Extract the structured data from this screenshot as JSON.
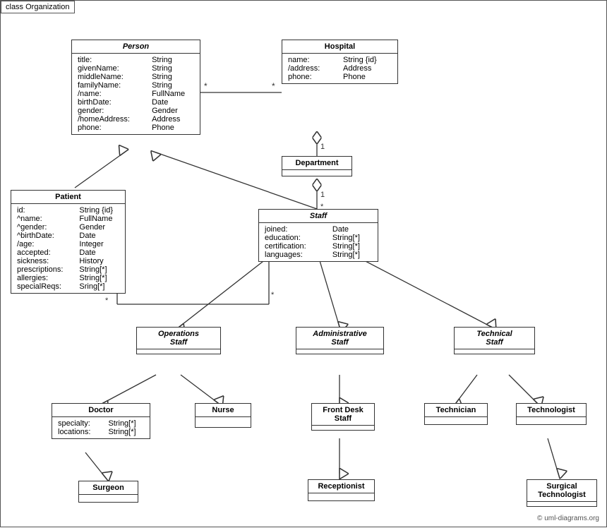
{
  "diagram": {
    "title": "class Organization",
    "copyright": "© uml-diagrams.org",
    "classes": {
      "person": {
        "name": "Person",
        "italic": true,
        "attrs": [
          [
            "title:",
            "String"
          ],
          [
            "givenName:",
            "String"
          ],
          [
            "middleName:",
            "String"
          ],
          [
            "familyName:",
            "String"
          ],
          [
            "/name:",
            "FullName"
          ],
          [
            "birthDate:",
            "Date"
          ],
          [
            "gender:",
            "Gender"
          ],
          [
            "/homeAddress:",
            "Address"
          ],
          [
            "phone:",
            "Phone"
          ]
        ]
      },
      "hospital": {
        "name": "Hospital",
        "italic": false,
        "attrs": [
          [
            "name:",
            "String {id}"
          ],
          [
            "/address:",
            "Address"
          ],
          [
            "phone:",
            "Phone"
          ]
        ]
      },
      "patient": {
        "name": "Patient",
        "italic": false,
        "attrs": [
          [
            "id:",
            "String {id}"
          ],
          [
            "^name:",
            "FullName"
          ],
          [
            "^gender:",
            "Gender"
          ],
          [
            "^birthDate:",
            "Date"
          ],
          [
            "/age:",
            "Integer"
          ],
          [
            "accepted:",
            "Date"
          ],
          [
            "sickness:",
            "History"
          ],
          [
            "prescriptions:",
            "String[*]"
          ],
          [
            "allergies:",
            "String[*]"
          ],
          [
            "specialReqs:",
            "Sring[*]"
          ]
        ]
      },
      "department": {
        "name": "Department",
        "italic": false,
        "attrs": []
      },
      "staff": {
        "name": "Staff",
        "italic": true,
        "attrs": [
          [
            "joined:",
            "Date"
          ],
          [
            "education:",
            "String[*]"
          ],
          [
            "certification:",
            "String[*]"
          ],
          [
            "languages:",
            "String[*]"
          ]
        ]
      },
      "operations_staff": {
        "name": "Operations\nStaff",
        "italic": true,
        "attrs": []
      },
      "administrative_staff": {
        "name": "Administrative\nStaff",
        "italic": true,
        "attrs": []
      },
      "technical_staff": {
        "name": "Technical\nStaff",
        "italic": true,
        "attrs": []
      },
      "doctor": {
        "name": "Doctor",
        "italic": false,
        "attrs": [
          [
            "specialty:",
            "String[*]"
          ],
          [
            "locations:",
            "String[*]"
          ]
        ]
      },
      "nurse": {
        "name": "Nurse",
        "italic": false,
        "attrs": []
      },
      "front_desk_staff": {
        "name": "Front Desk\nStaff",
        "italic": false,
        "attrs": []
      },
      "technician": {
        "name": "Technician",
        "italic": false,
        "attrs": []
      },
      "technologist": {
        "name": "Technologist",
        "italic": false,
        "attrs": []
      },
      "surgeon": {
        "name": "Surgeon",
        "italic": false,
        "attrs": []
      },
      "receptionist": {
        "name": "Receptionist",
        "italic": false,
        "attrs": []
      },
      "surgical_technologist": {
        "name": "Surgical\nTechnologist",
        "italic": false,
        "attrs": []
      }
    }
  }
}
